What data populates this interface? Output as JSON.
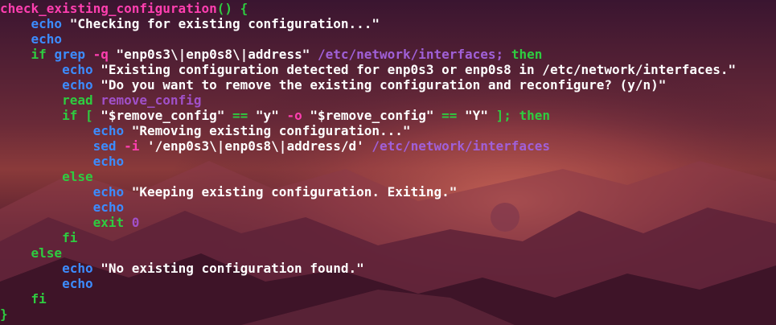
{
  "theme": {
    "function_color": "#ff3fb0",
    "keyword_color": "#3c8cff",
    "control_color": "#2ecc40",
    "string_color": "#ffffff",
    "path_color": "#a060d8"
  },
  "code": {
    "line1": {
      "fn": "check_existing_configuration",
      "paren": "() {"
    },
    "line2": {
      "cmd": "echo",
      "str": "\"Checking for existing configuration...\""
    },
    "line3": {
      "cmd": "echo"
    },
    "line4": {
      "kw": "if",
      "cmd": "grep",
      "opt": "-q",
      "str": "\"enp0s3\\|enp0s8\\|address\"",
      "path": "/etc/network/interfaces",
      "semi": ";",
      "then": "then"
    },
    "line5": {
      "cmd": "echo",
      "str": "\"Existing configuration detected for enp0s3 or enp0s8 in /etc/network/interfaces.\""
    },
    "line6": {
      "cmd": "echo",
      "str": "\"Do you want to remove the existing configuration and reconfigure? (y/n)\""
    },
    "line7": {
      "cmd": "read",
      "var": "remove_config"
    },
    "line8": {
      "kw": "if",
      "lb": "[",
      "s1": "\"$remove_config\"",
      "eq1": "==",
      "s2": "\"y\"",
      "o": "-o",
      "s3": "\"$remove_config\"",
      "eq2": "==",
      "s4": "\"Y\"",
      "rb": "];",
      "then": "then"
    },
    "line9": {
      "cmd": "echo",
      "str": "\"Removing existing configuration...\""
    },
    "line10": {
      "cmd": "sed",
      "opt": "-i",
      "str": "'/enp0s3\\|enp0s8\\|address/d'",
      "path": "/etc/network/interfaces"
    },
    "line11": {
      "cmd": "echo"
    },
    "line12": {
      "kw": "else"
    },
    "line13": {
      "cmd": "echo",
      "str": "\"Keeping existing configuration. Exiting.\""
    },
    "line14": {
      "cmd": "echo"
    },
    "line15": {
      "kw": "exit",
      "num": "0"
    },
    "line16": {
      "kw": "fi"
    },
    "line17": {
      "kw": "else"
    },
    "line18": {
      "cmd": "echo",
      "str": "\"No existing configuration found.\""
    },
    "line19": {
      "cmd": "echo"
    },
    "line20": {
      "kw": "fi"
    },
    "line21": {
      "brace": "}"
    }
  }
}
